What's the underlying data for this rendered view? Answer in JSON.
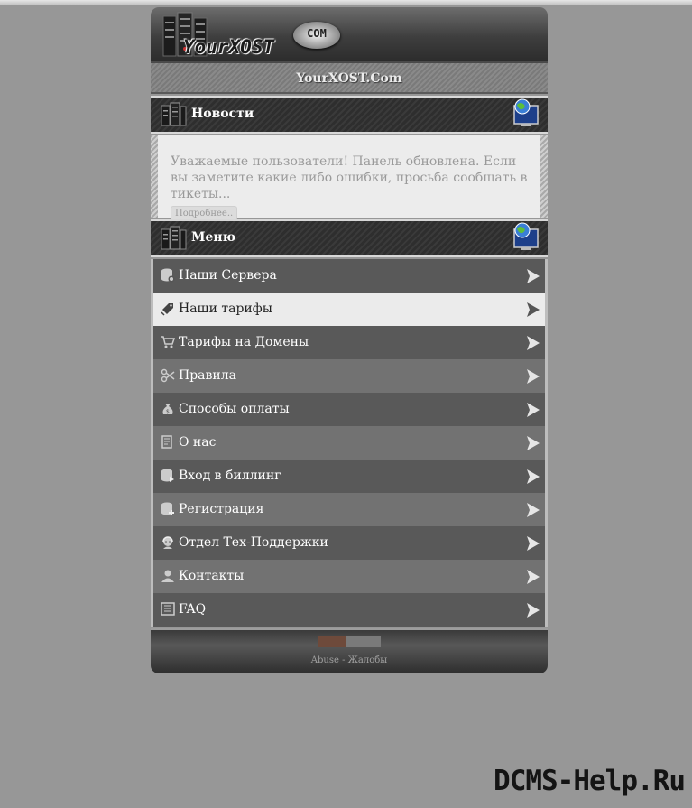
{
  "logo": {
    "word": "YourXOST",
    "com": "COM"
  },
  "site_bar": {
    "title": "YourXOST.Com"
  },
  "news": {
    "heading": "Новости",
    "text": "Уважаемые пользователи! Панель обновлена. Если вы заметите какие либо ошибки, просьба сообщать в тикеты...",
    "more_label": "Подробнее.."
  },
  "menu": {
    "heading": "Меню",
    "items": [
      {
        "label": "Наши Сервера",
        "icon": "database-icon"
      },
      {
        "label": "Наши тарифы",
        "icon": "tag-icon"
      },
      {
        "label": "Тарифы на Домены",
        "icon": "cart-icon"
      },
      {
        "label": "Правила",
        "icon": "scissors-icon"
      },
      {
        "label": "Способы оплаты",
        "icon": "money-bag-icon"
      },
      {
        "label": "О нас",
        "icon": "document-icon"
      },
      {
        "label": "Вход в биллинг",
        "icon": "database-arrow-icon"
      },
      {
        "label": "Регистрация",
        "icon": "database-plus-icon"
      },
      {
        "label": "Отдел Тех-Поддержки",
        "icon": "support-agent-icon"
      },
      {
        "label": "Контакты",
        "icon": "user-icon"
      },
      {
        "label": "FAQ",
        "icon": "list-icon"
      }
    ]
  },
  "footer": {
    "abuse": "Abuse - Жалобы"
  },
  "watermark": "DCMS-Help.Ru",
  "colors": {
    "page_bg": "#979797",
    "menu_dark": "#595959",
    "menu_light": "#727272",
    "menu_active": "#ebebeb"
  }
}
